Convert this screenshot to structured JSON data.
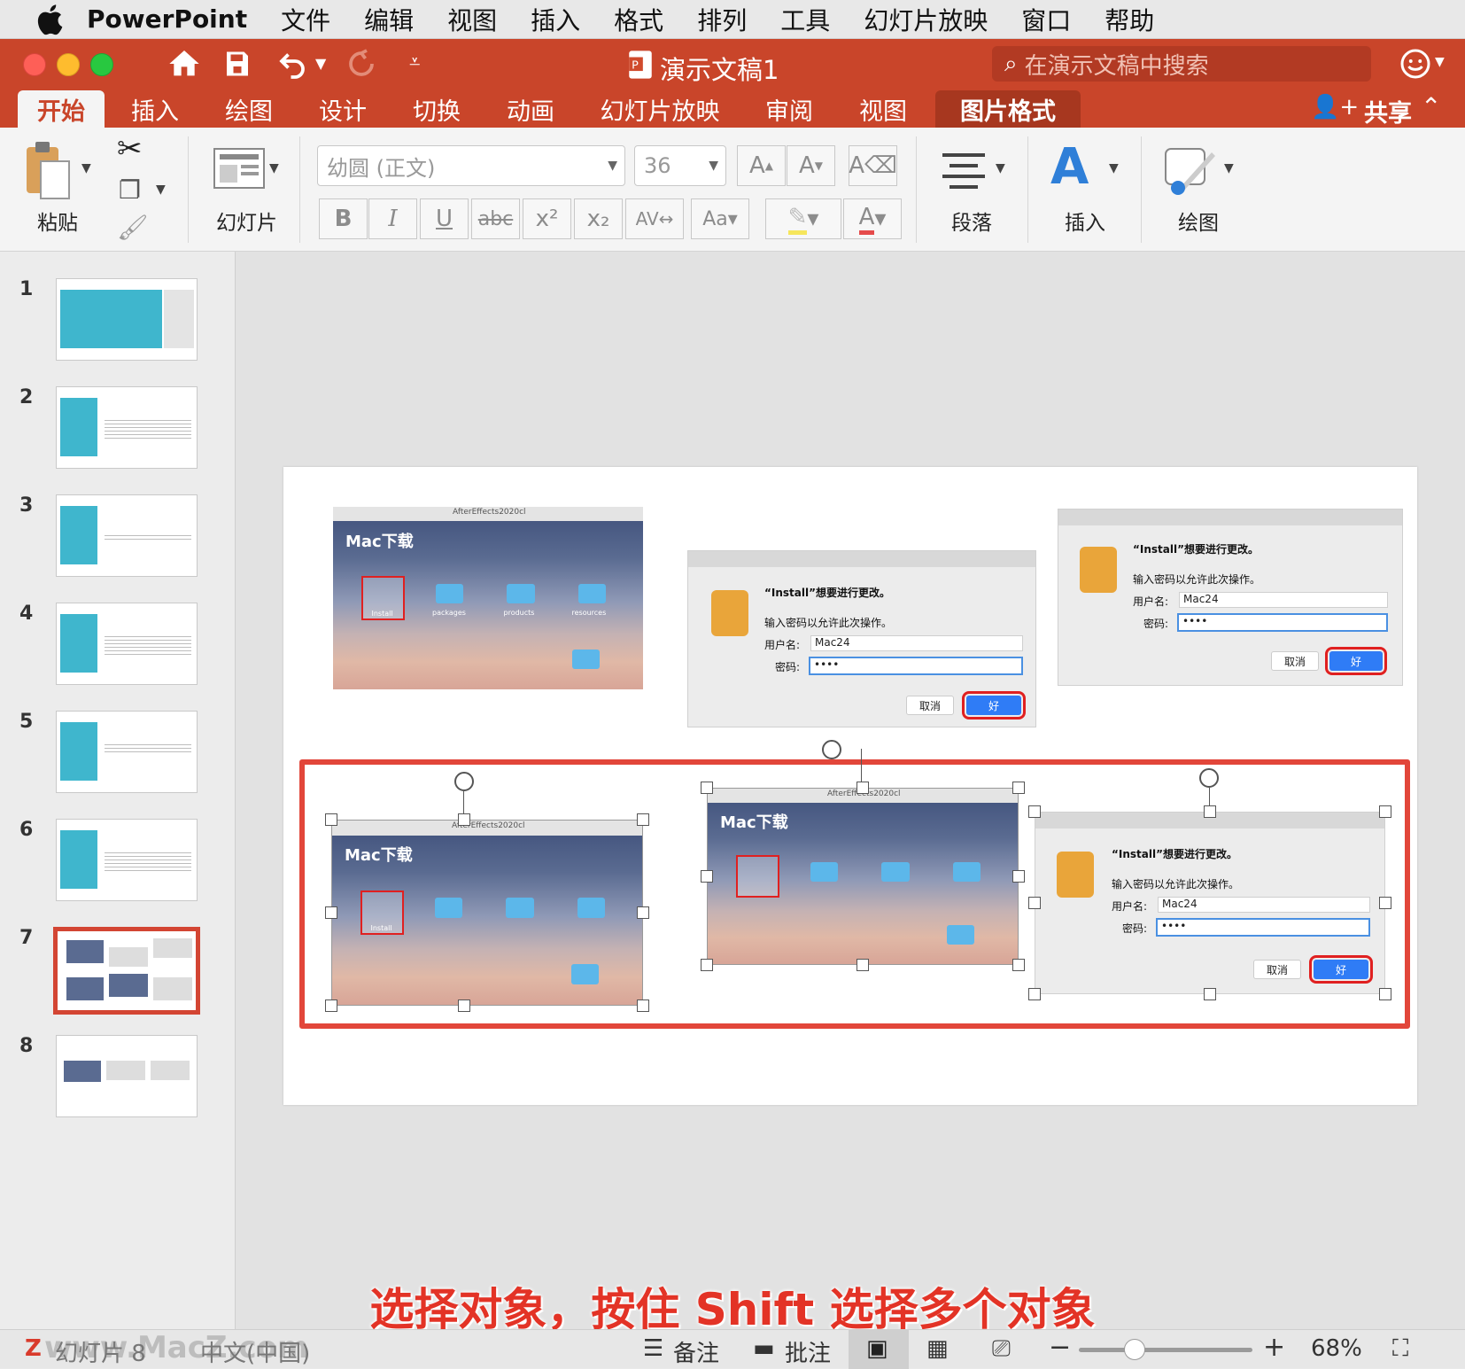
{
  "menubar": {
    "app": "PowerPoint",
    "items": [
      "文件",
      "编辑",
      "视图",
      "插入",
      "格式",
      "排列",
      "工具",
      "幻灯片放映",
      "窗口",
      "帮助"
    ]
  },
  "titlebar": {
    "doc_title": "演示文稿1",
    "search_placeholder": "在演示文稿中搜索"
  },
  "tabs": [
    "开始",
    "插入",
    "绘图",
    "设计",
    "切换",
    "动画",
    "幻灯片放映",
    "审阅",
    "视图",
    "图片格式"
  ],
  "share": "共享",
  "ribbon": {
    "paste": "粘贴",
    "slide": "幻灯片",
    "font_name": "幼圆 (正文)",
    "font_size": "36",
    "paragraph": "段落",
    "insert": "插入",
    "draw": "绘图"
  },
  "slides": {
    "numbers": [
      "1",
      "2",
      "3",
      "4",
      "5",
      "6",
      "7",
      "8"
    ],
    "selected": 7
  },
  "dialog": {
    "title": "“Install”想要进行更改。",
    "prompt": "输入密码以允许此次操作。",
    "user_label": "用户名:",
    "user_value": "Mac24",
    "pass_label": "密码:",
    "pass_value": "••••",
    "cancel": "取消",
    "ok": "好"
  },
  "shot": {
    "window_title": "AfterEffects2020cl",
    "brand": "Mac下载",
    "install": "Install",
    "packages": "packages",
    "products": "products",
    "resources": "resources"
  },
  "subtitle": "选择对象，按住 Shift 选择多个对象",
  "status": {
    "slide_info": "幻灯片 8",
    "lang": "中文(中国)",
    "notes": "备注",
    "comments": "批注",
    "zoom": "68%",
    "zoom_percent": 68,
    "watermark": "www.MacZ.com"
  },
  "colors": {
    "brand": "#c9452a",
    "highlight": "#e02020",
    "accent": "#3fb6cd"
  }
}
